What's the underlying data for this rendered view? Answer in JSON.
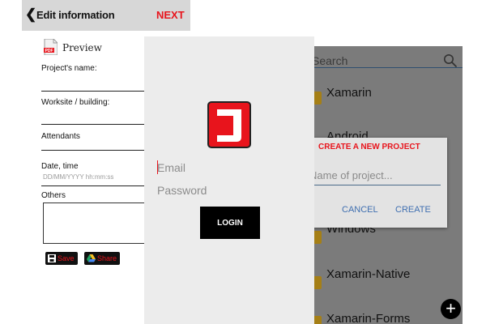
{
  "edit_screen": {
    "back_icon": "chevron-left-icon",
    "title": "Edit information",
    "next_label": "NEXT",
    "pdf_icon": "pdf-icon",
    "preview_label": "Preview",
    "fields": {
      "project_name_label": "Project's name:",
      "worksite_label": "Worksite / building:",
      "attendants_label": "Attendants",
      "date_time_label": "Date, time",
      "date_placeholder": "DD/MM/YYYY hh:mm:ss",
      "others_label": "Others"
    },
    "save_label": "Save",
    "share_label": "Share",
    "accent_color": "#e8141c",
    "header_color": "#d7d7d7"
  },
  "login_screen": {
    "logo_icon": "app-logo-icon",
    "email_placeholder": "Email",
    "password_placeholder": "Password",
    "login_label": "LOGIN"
  },
  "list_screen": {
    "search_placeholder": "Search",
    "search_icon": "search-icon",
    "items": [
      {
        "label": "Xamarin"
      },
      {
        "label": "Android"
      },
      {
        "label": "Windows"
      },
      {
        "label": "Xamarin-Native"
      },
      {
        "label": "Xamarin-Forms"
      }
    ],
    "dialog": {
      "title": "CREATE A NEW PROJECT",
      "input_placeholder": "Name of project...",
      "cancel_label": "CANCEL",
      "create_label": "CREATE"
    },
    "add_icon": "plus-icon"
  }
}
